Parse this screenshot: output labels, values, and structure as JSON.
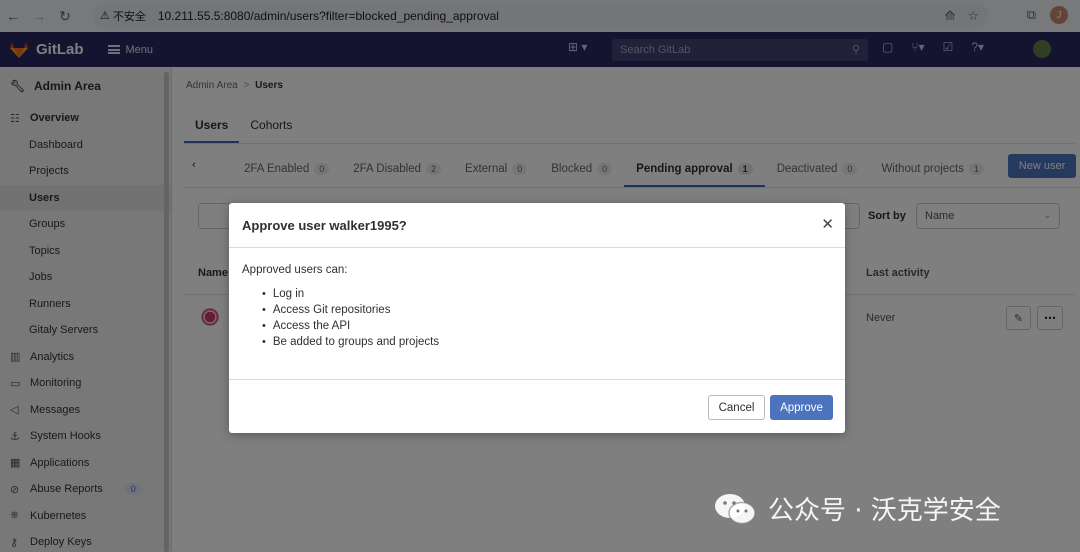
{
  "browser": {
    "security_label": "不安全",
    "url": "10.211.55.5:8080/admin/users?filter=blocked_pending_approval",
    "profile_initial": "J"
  },
  "topbar": {
    "brand": "GitLab",
    "menu_label": "Menu",
    "search_placeholder": "Search GitLab"
  },
  "sidebar": {
    "title": "Admin Area",
    "items": [
      {
        "label": "Overview",
        "icon": "grid-icon",
        "level": "section"
      },
      {
        "label": "Dashboard",
        "level": "sub"
      },
      {
        "label": "Projects",
        "level": "sub"
      },
      {
        "label": "Users",
        "level": "sub",
        "active": true
      },
      {
        "label": "Groups",
        "level": "sub"
      },
      {
        "label": "Topics",
        "level": "sub"
      },
      {
        "label": "Jobs",
        "level": "sub"
      },
      {
        "label": "Runners",
        "level": "sub"
      },
      {
        "label": "Gitaly Servers",
        "level": "sub"
      },
      {
        "label": "Analytics",
        "icon": "chart-icon",
        "level": "top"
      },
      {
        "label": "Monitoring",
        "icon": "monitor-icon",
        "level": "top"
      },
      {
        "label": "Messages",
        "icon": "megaphone-icon",
        "level": "top"
      },
      {
        "label": "System Hooks",
        "icon": "hook-icon",
        "level": "top"
      },
      {
        "label": "Applications",
        "icon": "apps-icon",
        "level": "top"
      },
      {
        "label": "Abuse Reports",
        "icon": "report-icon",
        "level": "top",
        "badge": "0"
      },
      {
        "label": "Kubernetes",
        "icon": "kubernetes-icon",
        "level": "top"
      },
      {
        "label": "Deploy Keys",
        "icon": "key-icon",
        "level": "top"
      }
    ]
  },
  "breadcrumb": {
    "parent": "Admin Area",
    "separator": ">",
    "current": "Users"
  },
  "primary_tabs": [
    {
      "label": "Users",
      "active": true
    },
    {
      "label": "Cohorts",
      "active": false
    }
  ],
  "filter_tabs": [
    {
      "label": "2FA Enabled",
      "count": "0"
    },
    {
      "label": "2FA Disabled",
      "count": "2"
    },
    {
      "label": "External",
      "count": "0"
    },
    {
      "label": "Blocked",
      "count": "0"
    },
    {
      "label": "Pending approval",
      "count": "1",
      "active": true
    },
    {
      "label": "Deactivated",
      "count": "0"
    },
    {
      "label": "Without projects",
      "count": "1"
    }
  ],
  "new_user_label": "New user",
  "sort": {
    "label": "Sort by",
    "value": "Name"
  },
  "table": {
    "col_name": "Name",
    "col_last_activity": "Last activity",
    "rows": [
      {
        "last_activity": "Never"
      }
    ]
  },
  "modal": {
    "title": "Approve user walker1995?",
    "intro": "Approved users can:",
    "permissions": [
      "Log in",
      "Access Git repositories",
      "Access the API",
      "Be added to groups and projects"
    ],
    "cancel_label": "Cancel",
    "approve_label": "Approve"
  },
  "watermark": {
    "text": "公众号 · 沃克学安全"
  },
  "colors": {
    "topbar": "#292961",
    "primary": "#4d72be",
    "sidebar_bg": "#f0f0f0"
  }
}
